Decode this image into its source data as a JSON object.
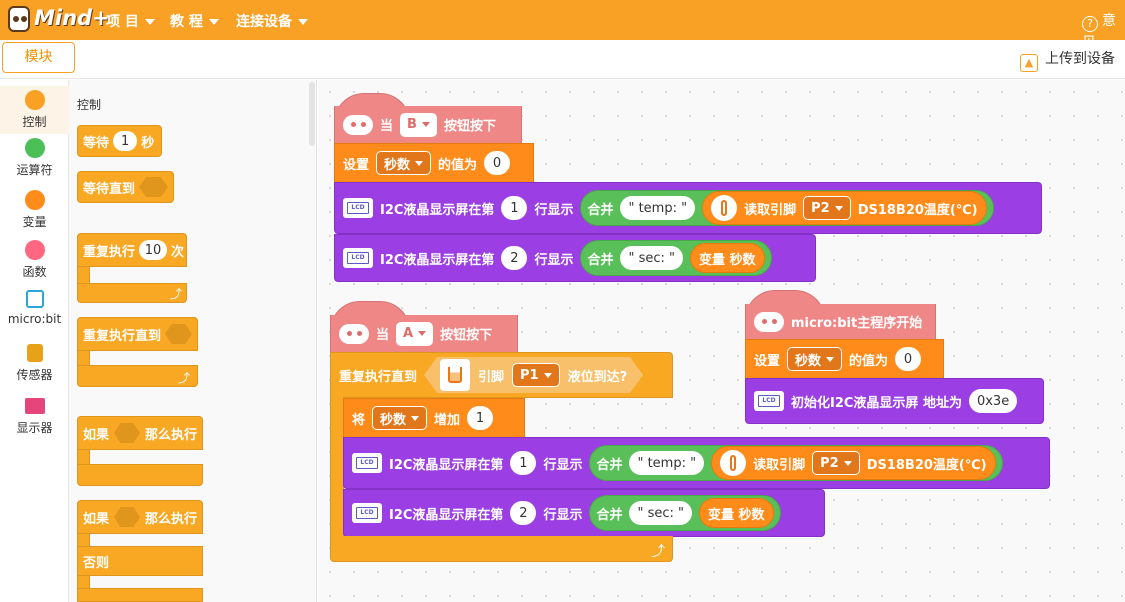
{
  "app": {
    "logo": "Mind+"
  },
  "menu": [
    {
      "label": "项 目"
    },
    {
      "label": "教 程"
    },
    {
      "label": "连接设备"
    }
  ],
  "help": {
    "label": "意见"
  },
  "subbar": {
    "tab_label": "模块",
    "upload_label": "上传到设备"
  },
  "categories": [
    {
      "label": "控制",
      "color": "#f8a124"
    },
    {
      "label": "运算符",
      "color": "#4cbf56"
    },
    {
      "label": "变量",
      "color": "#ff8c1a"
    },
    {
      "label": "函数",
      "color": "#ff6680"
    },
    {
      "label": "micro:bit",
      "color": "#2aa7d6"
    },
    {
      "label": "传感器",
      "color": "#e8761a"
    },
    {
      "label": "显示器",
      "color": "#e5457a"
    }
  ],
  "palette": {
    "section_title": "控制",
    "wait": {
      "label": "等待",
      "value": "1",
      "unit": "秒"
    },
    "wait_until": {
      "label": "等待直到"
    },
    "repeat": {
      "label": "重复执行",
      "value": "10",
      "unit": "次"
    },
    "repeat_until": {
      "label": "重复执行直到"
    },
    "if_then": {
      "label": "如果",
      "then": "那么执行"
    },
    "if_else": {
      "label": "如果",
      "then": "那么执行",
      "else": "否则"
    }
  },
  "script1": {
    "hat_when": "当",
    "hat_button": "B",
    "hat_pressed": "按钮按下",
    "set_label": "设置",
    "set_var": "秒数",
    "set_to": "的值为",
    "set_value": "0",
    "lcd1_label": "I2C液晶显示屏在第",
    "lcd1_line": "1",
    "lcd1_show": "行显示",
    "join": "合并",
    "temp_str": "\" temp: \"",
    "read_pin": "读取引脚",
    "pin": "P2",
    "sensor": "DS18B20温度(℃)",
    "lcd2_label": "I2C液晶显示屏在第",
    "lcd2_line": "2",
    "lcd2_show": "行显示",
    "sec_str": "\" sec: \"",
    "var_label": "变量 秒数"
  },
  "script2": {
    "hat_when": "当",
    "hat_button": "A",
    "hat_pressed": "按钮按下",
    "repeat_until": "重复执行直到",
    "pin_label": "引脚",
    "pin": "P1",
    "level": "液位到达?",
    "change_label": "将",
    "change_var": "秒数",
    "change_op": "增加",
    "change_value": "1",
    "lcd1_label": "I2C液晶显示屏在第",
    "lcd1_line": "1",
    "lcd1_show": "行显示",
    "join": "合并",
    "temp_str": "\" temp: \"",
    "read_pin": "读取引脚",
    "pin2": "P2",
    "sensor": "DS18B20温度(℃)",
    "lcd2_label": "I2C液晶显示屏在第",
    "lcd2_line": "2",
    "lcd2_show": "行显示",
    "sec_str": "\" sec: \"",
    "var_label": "变量 秒数"
  },
  "script3": {
    "hat_label": "micro:bit主程序开始",
    "set_label": "设置",
    "set_var": "秒数",
    "set_to": "的值为",
    "set_value": "0",
    "init_label": "初始化I2C液晶显示屏 地址为",
    "address": "0x3e"
  }
}
